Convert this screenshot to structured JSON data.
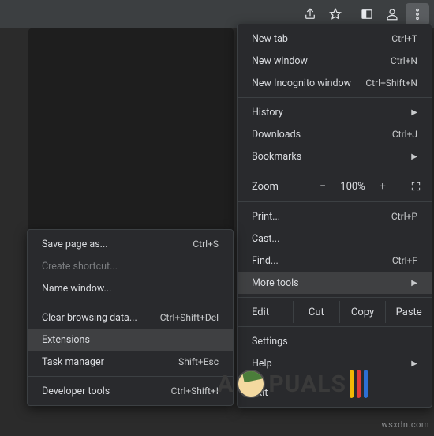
{
  "toolbar": {
    "icons": [
      "share-icon",
      "star-icon",
      "panel-icon",
      "profile-icon",
      "kebab-icon"
    ]
  },
  "menu": {
    "new_tab": {
      "label": "New tab",
      "shortcut": "Ctrl+T"
    },
    "new_window": {
      "label": "New window",
      "shortcut": "Ctrl+N"
    },
    "new_incognito": {
      "label": "New Incognito window",
      "shortcut": "Ctrl+Shift+N"
    },
    "history": {
      "label": "History"
    },
    "downloads": {
      "label": "Downloads",
      "shortcut": "Ctrl+J"
    },
    "bookmarks": {
      "label": "Bookmarks"
    },
    "zoom": {
      "label": "Zoom",
      "minus": "−",
      "value": "100%",
      "plus": "+"
    },
    "print": {
      "label": "Print...",
      "shortcut": "Ctrl+P"
    },
    "cast": {
      "label": "Cast..."
    },
    "find": {
      "label": "Find...",
      "shortcut": "Ctrl+F"
    },
    "more_tools": {
      "label": "More tools"
    },
    "edit": {
      "label": "Edit",
      "cut": "Cut",
      "copy": "Copy",
      "paste": "Paste"
    },
    "settings": {
      "label": "Settings"
    },
    "help": {
      "label": "Help"
    },
    "exit": {
      "label": "Exit"
    }
  },
  "submenu": {
    "save_page": {
      "label": "Save page as...",
      "shortcut": "Ctrl+S"
    },
    "create_shortcut": {
      "label": "Create shortcut..."
    },
    "name_window": {
      "label": "Name window..."
    },
    "clear_data": {
      "label": "Clear browsing data...",
      "shortcut": "Ctrl+Shift+Del"
    },
    "extensions": {
      "label": "Extensions"
    },
    "task_manager": {
      "label": "Task manager",
      "shortcut": "Shift+Esc"
    },
    "dev_tools": {
      "label": "Developer tools",
      "shortcut": "Ctrl+Shift+I"
    }
  },
  "watermark": {
    "text_left": "A",
    "text_right": "PUALS",
    "src": "wsxdn.com"
  }
}
